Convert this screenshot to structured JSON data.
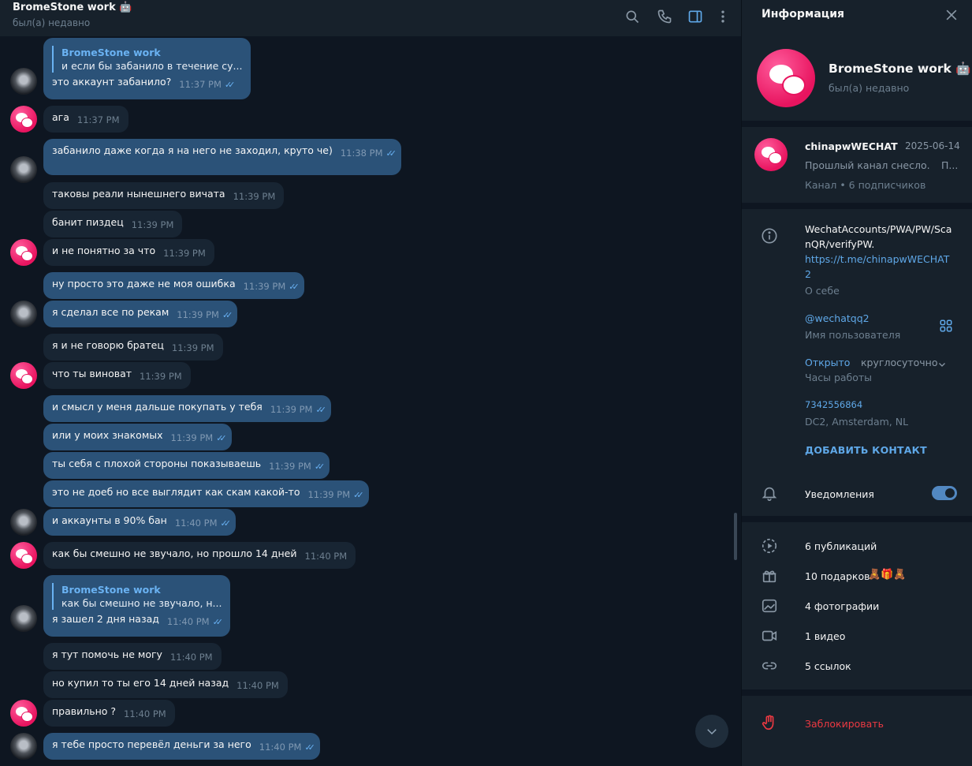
{
  "chat": {
    "title": "BromeStone work 🤖",
    "status": "был(а) недавно",
    "header_icons": [
      "search-icon",
      "phone-icon",
      "sidebar-icon",
      "more-icon"
    ],
    "messages": [
      {
        "dir": "out",
        "reply_name": "BromeStone work",
        "reply_text": "и если бы забанило в течение су...",
        "text": "это аккаунт забанило?",
        "time": "11:37 PM",
        "read": true
      },
      {
        "dir": "in",
        "text": "ага",
        "time": "11:37 PM"
      },
      {
        "dir": "out",
        "text": "забанило даже когда я на него не заходил, круто че)",
        "time": "11:38 PM",
        "read": true
      },
      {
        "dir": "in",
        "text": "таковы реали нынешнего вичата",
        "time": "11:39 PM"
      },
      {
        "dir": "in",
        "text": "банит пиздец",
        "time": "11:39 PM"
      },
      {
        "dir": "in",
        "text": "и не понятно за что",
        "time": "11:39 PM"
      },
      {
        "dir": "out",
        "text": "ну просто это даже не моя ошибка",
        "time": "11:39 PM",
        "read": true
      },
      {
        "dir": "out",
        "text": "я сделал все по рекам",
        "time": "11:39 PM",
        "read": true
      },
      {
        "dir": "in",
        "text": "я и не говорю братец",
        "time": "11:39 PM"
      },
      {
        "dir": "in",
        "text": "что ты виноват",
        "time": "11:39 PM"
      },
      {
        "dir": "out",
        "text": "и смысл у меня дальше покупать у тебя",
        "time": "11:39 PM",
        "read": true
      },
      {
        "dir": "out",
        "text": "или у моих знакомых",
        "time": "11:39 PM",
        "read": true
      },
      {
        "dir": "out",
        "text": "ты себя с плохой стороны показываешь",
        "time": "11:39 PM",
        "read": true
      },
      {
        "dir": "out",
        "text": "это не доеб но все выглядит как скам какой-то",
        "time": "11:39 PM",
        "read": true
      },
      {
        "dir": "out",
        "text": "и аккаунты в 90% бан",
        "time": "11:40 PM",
        "read": true
      },
      {
        "dir": "in",
        "text": "как бы смешно не звучало, но прошло 14 дней",
        "time": "11:40 PM"
      },
      {
        "dir": "out",
        "reply_name": "BromeStone work",
        "reply_text": "как бы смешно не звучало, н...",
        "text": "я зашел 2 дня назад",
        "time": "11:40 PM",
        "read": true
      },
      {
        "dir": "in",
        "text": "я тут помочь не могу",
        "time": "11:40 PM"
      },
      {
        "dir": "in",
        "text": "но купил то ты его 14 дней назад",
        "time": "11:40 PM"
      },
      {
        "dir": "in",
        "text": "правильно ?",
        "time": "11:40 PM"
      },
      {
        "dir": "out",
        "text": "я тебе просто перевёл деньги за него",
        "time": "11:40 PM",
        "read": true
      }
    ]
  },
  "info": {
    "title": "Информация",
    "profile": {
      "name": "BromeStone work 🤖",
      "status": "был(а) недавно"
    },
    "channel": {
      "name": "chinapwWECHAT",
      "date": "2025-06-14",
      "preview": "Прошлый канал снесло.",
      "preview_more": "П...",
      "subscribers": "Канал • 6 подписчиков"
    },
    "bio": {
      "line1": "WechatAccounts/PWA/PW/Sca",
      "line2": "nQR/verifyPW.",
      "link1": "https://t.me/chinapwWECHAT",
      "link2": "2",
      "label": "О себе"
    },
    "username": {
      "value": "@wechatqq2",
      "label": "Имя пользователя"
    },
    "hours": {
      "status": "Открыто",
      "value": "круглосуточно",
      "label": "Часы работы"
    },
    "phone": {
      "value": "7342556864",
      "location": "DC2, Amsterdam, NL"
    },
    "add_contact": "ДОБАВИТЬ КОНТАКТ",
    "notifications": {
      "label": "Уведомления",
      "enabled": true
    },
    "media": {
      "posts": "6 публикаций",
      "gifts": "10 подарков",
      "gifts_emoji": "🧸🎁🧸",
      "photos": "4 фотографии",
      "videos": "1 видео",
      "links": "5 ссылок"
    },
    "block": "Заблокировать",
    "colors": {
      "accent": "#5288c1",
      "link": "#5fa8e8",
      "danger": "#ec3942",
      "out_bubble": "#2b5278",
      "in_bubble": "#182533"
    }
  }
}
